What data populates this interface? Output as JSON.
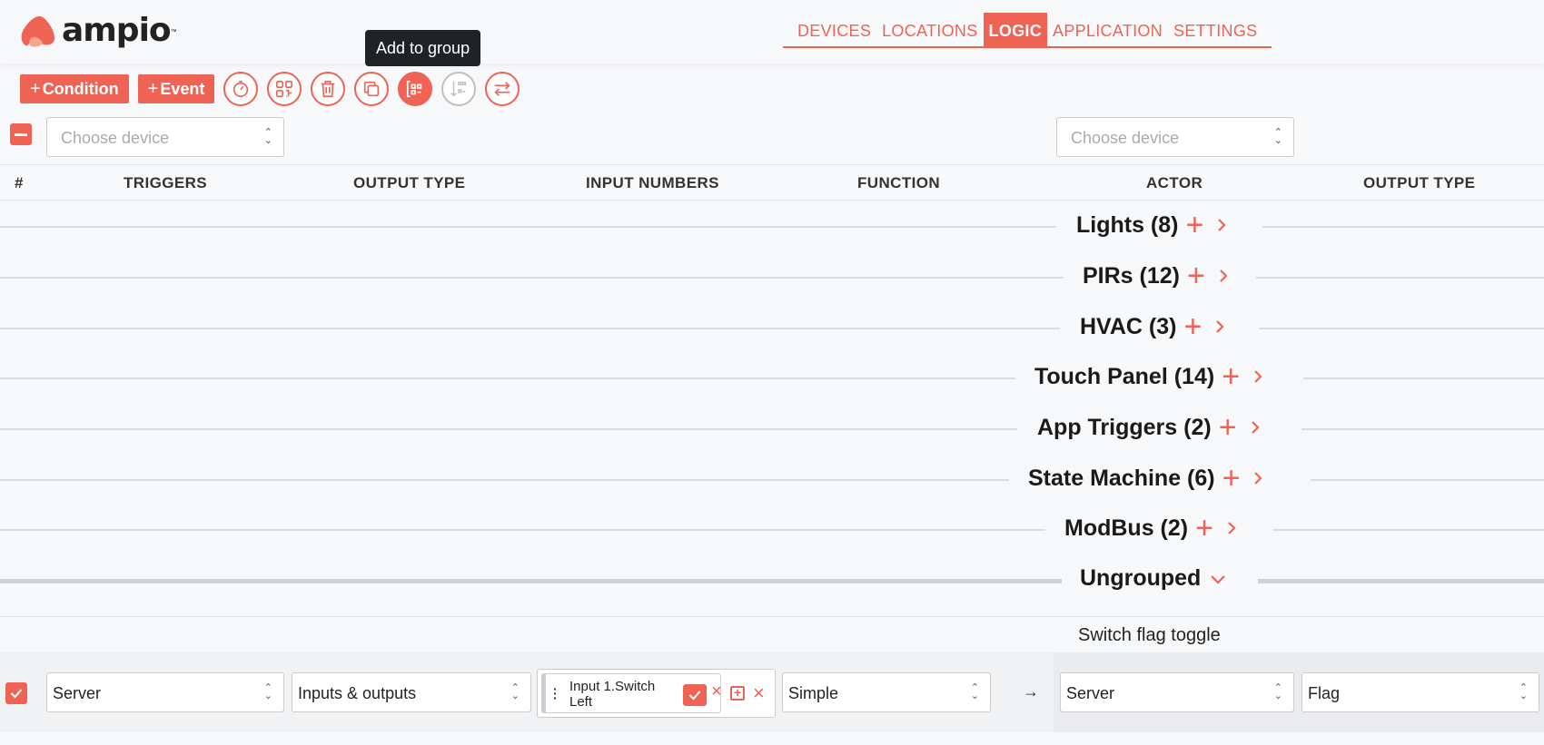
{
  "app": {
    "logo_text": "ampio",
    "logo_tm": "™"
  },
  "nav": {
    "items": [
      {
        "label": "DEVICES",
        "active": false
      },
      {
        "label": "LOCATIONS",
        "active": false
      },
      {
        "label": "LOGIC",
        "active": true
      },
      {
        "label": "APPLICATION",
        "active": false
      },
      {
        "label": "SETTINGS",
        "active": false
      }
    ]
  },
  "toolbar": {
    "condition_label": "Condition",
    "event_label": "Event",
    "tooltip": "Add to group",
    "icons": [
      "timer-icon",
      "qr-code-icon",
      "trash-icon",
      "copy-icon",
      "add-to-group-icon",
      "sort-icon",
      "swap-icon"
    ]
  },
  "filters": {
    "left_placeholder": "Choose device",
    "right_placeholder": "Choose device"
  },
  "table": {
    "headers": {
      "index": "#",
      "triggers": "TRIGGERS",
      "output_type": "OUTPUT TYPE",
      "input_numbers": "INPUT NUMBERS",
      "function": "FUNCTION",
      "actor": "ACTOR",
      "output_type_2": "OUTPUT TYPE"
    }
  },
  "groups": [
    {
      "label": "Lights (8)",
      "expanded": false
    },
    {
      "label": "PIRs (12)",
      "expanded": false
    },
    {
      "label": "HVAC (3)",
      "expanded": false
    },
    {
      "label": "Touch Panel (14)",
      "expanded": false
    },
    {
      "label": "App Triggers (2)",
      "expanded": false
    },
    {
      "label": "State Machine (6)",
      "expanded": false
    },
    {
      "label": "ModBus (2)",
      "expanded": false
    },
    {
      "label": "Ungrouped",
      "expanded": true
    }
  ],
  "row": {
    "title": "Switch flag toggle",
    "checked": true,
    "trigger": "Server",
    "output_type": "Inputs & outputs",
    "input_chip": "Input 1.Switch Left",
    "function": "Simple",
    "actor": "Server",
    "actor_output_type": "Flag",
    "arrow": "→"
  },
  "colors": {
    "accent": "#ef6355",
    "background": "#f7f8fa",
    "tooltip_bg": "#1f2328"
  }
}
